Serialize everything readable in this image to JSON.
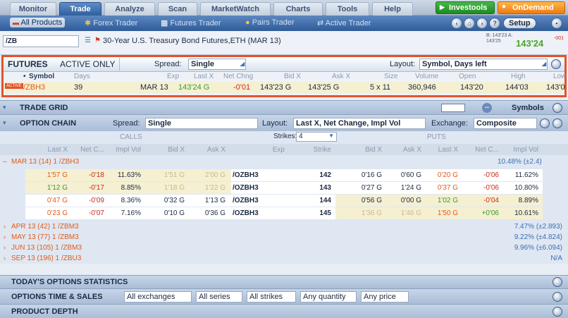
{
  "top_tabs": [
    "Monitor",
    "Trade",
    "Analyze",
    "Scan",
    "MarketWatch",
    "Charts",
    "Tools",
    "Help"
  ],
  "active_tab": "Trade",
  "investools_label": "Investools",
  "ondemand_label": "OnDemand",
  "sub_nav": [
    "All Products",
    "Forex Trader",
    "Futures Trader",
    "Pairs Trader",
    "Active Trader"
  ],
  "setup_label": "Setup",
  "symbol": {
    "input": "/ZB",
    "description": "30-Year U.S. Treasury Bond Futures,ETH (MAR 13)",
    "bid_ask_small": "B: 143'23  A: 143'25",
    "last": "143'24",
    "change_small": "-001"
  },
  "futures": {
    "title": "FUTURES",
    "filter": "ACTIVE ONLY",
    "spread_label": "Spread:",
    "spread_value": "Single",
    "layout_label": "Layout:",
    "layout_value": "Symbol, Days left",
    "columns": [
      "Symbol",
      "Days",
      "Exp",
      "Last X",
      "Net Chng",
      "Bid X",
      "Ask X",
      "Size",
      "Volume",
      "Open",
      "High",
      "Low"
    ],
    "row": {
      "badge": "ACTIVE",
      "symbol": "/ZBH3",
      "days": "39",
      "exp": "MAR 13",
      "last": "143'24 G",
      "net": "-0'01",
      "bid": "143'23 G",
      "ask": "143'25 G",
      "size": "5 x 11",
      "volume": "360,946",
      "open": "143'20",
      "high": "144'03",
      "low": "143'0"
    }
  },
  "trade_grid": {
    "title": "TRADE GRID",
    "symbols_label": "Symbols"
  },
  "option_chain": {
    "title": "OPTION CHAIN",
    "spread_label": "Spread:",
    "spread_value": "Single",
    "layout_label": "Layout:",
    "layout_value": "Last X, Net Change, Impl Vol",
    "exchange_label": "Exchange:",
    "exchange_value": "Composite",
    "calls_label": "CALLS",
    "puts_label": "PUTS",
    "strikes_label": "Strikes:",
    "strikes_value": "4",
    "call_columns": [
      "Last X",
      "Net C...",
      "Impl Vol",
      "Bid X",
      "Ask X"
    ],
    "mid_columns": [
      "Exp",
      "Strike"
    ],
    "put_columns": [
      "Bid X",
      "Ask X",
      "Last X",
      "Net C...",
      "Impl Vol"
    ],
    "expanded": {
      "label": "MAR 13  (14)  1 /ZBH3",
      "iv": "10.48% (±2.4)",
      "rows": [
        {
          "c_last": "1'57 G",
          "c_net": "-0'18",
          "c_iv": "11.63%",
          "c_bid": "1'51 G",
          "c_ask": "2'00 G",
          "exp": "/OZBH3",
          "strike": "142",
          "p_bid": "0'16 G",
          "p_ask": "0'60 G",
          "p_last": "0'20 G",
          "p_net": "-0'06",
          "p_iv": "11.62%"
        },
        {
          "c_last": "1'12 G",
          "c_net": "-0'17",
          "c_iv": "8.85%",
          "c_bid": "1'18 G",
          "c_ask": "1'22 G",
          "exp": "/OZBH3",
          "strike": "143",
          "p_bid": "0'27 G",
          "p_ask": "1'24 G",
          "p_last": "0'37 G",
          "p_net": "-0'06",
          "p_iv": "10.80%"
        },
        {
          "c_last": "0'47 G",
          "c_net": "-0'09",
          "c_iv": "8.36%",
          "c_bid": "0'32 G",
          "c_ask": "1'13 G",
          "exp": "/OZBH3",
          "strike": "144",
          "p_bid": "0'56 G",
          "p_ask": "0'00 G",
          "p_last": "1'02 G",
          "p_net": "-0'04",
          "p_iv": "8.89%"
        },
        {
          "c_last": "0'23 G",
          "c_net": "-0'07",
          "c_iv": "7.16%",
          "c_bid": "0'10 G",
          "c_ask": "0'36 G",
          "exp": "/OZBH3",
          "strike": "145",
          "p_bid": "1'36 G",
          "p_ask": "1'46 G",
          "p_last": "1'50 G",
          "p_net": "+0'06",
          "p_iv": "10.61%"
        }
      ]
    },
    "collapsed": [
      {
        "label": "APR 13  (42)  1 /ZBM3",
        "iv": "7.47% (±2.893)"
      },
      {
        "label": "MAY 13  (77)  1 /ZBM3",
        "iv": "9.22% (±4.824)"
      },
      {
        "label": "JUN 13  (105)  1 /ZBM3",
        "iv": "9.96% (±6.094)"
      },
      {
        "label": "SEP 13  (196)  1 /ZBU3",
        "iv": "N/A"
      }
    ]
  },
  "todays_stats": {
    "title": "TODAY'S OPTIONS STATISTICS"
  },
  "time_sales": {
    "title": "OPTIONS TIME & SALES",
    "filters": [
      "All exchanges",
      "All series",
      "All strikes",
      "Any quantity",
      "Any price"
    ]
  },
  "product_depth": {
    "title": "PRODUCT DEPTH"
  }
}
